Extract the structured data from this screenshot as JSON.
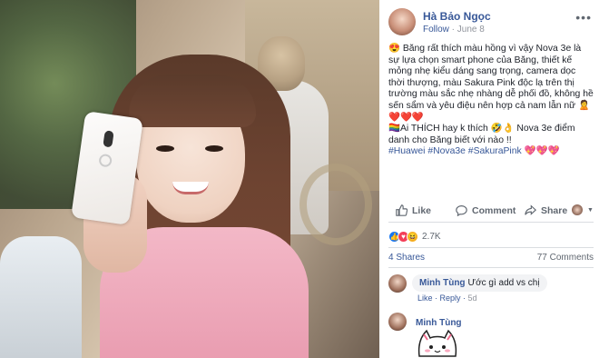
{
  "post": {
    "author": "Hà Bảo Ngọc",
    "follow_label": "Follow",
    "separator": " · ",
    "date": "June 8",
    "text_lines": [
      "😍 Băng rất thích màu hồng vì vậy Nova 3e là sự lựa chọn smart phone của Băng, thiết kế mỏng nhẹ kiểu dáng sang trọng, camera dọc thời thượng, màu Sakura Pink độc lạ trên thị trường màu sắc nhẹ nhàng dễ phối đồ, không hề sến sẩm và yêu điệu nên hợp cả nam lẫn nữ 🙎❤️❤️❤️",
      "🏳️‍🌈Ai THÍCH hay k thích 🤣👌 Nova 3e điểm danh cho Băng biết với nào !!"
    ],
    "hashtags": "#Huawei #Nova3e #SakuraPink 💖💖💖"
  },
  "actions": {
    "like": "Like",
    "comment": "Comment",
    "share": "Share"
  },
  "stats": {
    "reaction_count": "2.7K",
    "shares": "4 Shares",
    "comments": "77 Comments"
  },
  "comments": [
    {
      "name": "Minh Tùng",
      "text": "Ước gì add vs chị",
      "like_label": "Like",
      "reply_label": "Reply",
      "time": "5d"
    },
    {
      "name": "Minh Tùng"
    }
  ],
  "colors": {
    "link": "#385898",
    "like_blue": "#1877f2",
    "love_red": "#f33e58",
    "haha_yellow": "#f7b125"
  }
}
